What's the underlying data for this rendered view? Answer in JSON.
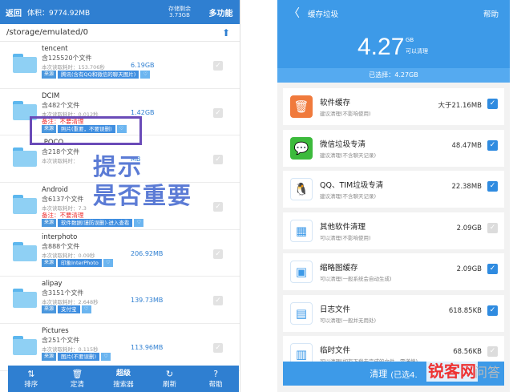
{
  "left": {
    "topbar": {
      "back": "返回",
      "volume": "体积：9774.92MB",
      "storage_line1": "存储剩余",
      "storage_line2": "3.73GB",
      "more": "多功能"
    },
    "path": "/storage/emulated/0",
    "folders": [
      {
        "name": "tencent",
        "count": "含125520个文件",
        "time": "本次读取耗时：153.706秒",
        "size": "6.19GB",
        "tag_a": "来源",
        "tag_b": "腾讯(含有QQ和微信的聊天图片)",
        "note": ""
      },
      {
        "name": "DCIM",
        "count": "含482个文件",
        "time": "本次读取耗时：0.012秒",
        "size": "1.42GB",
        "tag_a": "来源",
        "tag_b": "照片(重要，不要误删)",
        "note": "备注：不要清理"
      },
      {
        "name": ".POCO",
        "count": "含218个文件",
        "time": "本次读取耗时：",
        "size": "MB",
        "tag_a": "",
        "tag_b": "",
        "note": ""
      },
      {
        "name": "Android",
        "count": "含6137个文件",
        "time": "本次读取耗时：7.3",
        "size": "",
        "tag_a": "来源",
        "tag_b": "软件数据(谨防误删)-进入查看",
        "note": "备注：不要清理"
      },
      {
        "name": "interphoto",
        "count": "含888个文件",
        "time": "本次读取耗时：0.09秒",
        "size": "206.92MB",
        "tag_a": "来源",
        "tag_b": "印象InterPhoto",
        "note": ""
      },
      {
        "name": "alipay",
        "count": "含3151个文件",
        "time": "本次读取耗时：2.648秒",
        "size": "139.73MB",
        "tag_a": "来源",
        "tag_b": "支付宝",
        "note": ""
      },
      {
        "name": "Pictures",
        "count": "含251个文件",
        "time": "本次读取耗时：0.115秒",
        "size": "113.96MB",
        "tag_a": "来源",
        "tag_b": "图片(不要误删)",
        "note": ""
      }
    ],
    "overlay_line1": "提示",
    "overlay_line2": "是否重要",
    "bottom_nav": [
      {
        "icon": "⇅",
        "label": "排序"
      },
      {
        "icon": "🗑",
        "label": "定清"
      },
      {
        "icon": "超级",
        "label": "搜索器"
      },
      {
        "icon": "↻",
        "label": "刷新"
      },
      {
        "icon": "?",
        "label": "帮助"
      }
    ]
  },
  "right": {
    "header": {
      "back": "〈",
      "title": "缓存垃圾",
      "help": "帮助",
      "amount": "4.27",
      "unit": "GB",
      "unit_sub": "可以清理"
    },
    "selected_bar": "已选择：4.27GB",
    "items": [
      {
        "title": "软件缓存",
        "desc": "建议清理(不影响使用)",
        "size": "大于21.16MB",
        "checked": true,
        "icon": "trash-icon",
        "color": "#f07a3c"
      },
      {
        "title": "微信垃圾专清",
        "desc": "建议清理(不含聊天记录)",
        "size": "48.47MB",
        "checked": true,
        "icon": "wechat-icon",
        "color": "#3cba3c"
      },
      {
        "title": "QQ、TIM垃圾专清",
        "desc": "建议清理(不含聊天记录)",
        "size": "22.38MB",
        "checked": true,
        "icon": "qq-icon",
        "color": "#ffffff"
      },
      {
        "title": "其他软件清理",
        "desc": "可以清理(不影响使用)",
        "size": "2.09GB",
        "checked": false,
        "icon": "apps-icon",
        "color": "#ffffff"
      },
      {
        "title": "缩略图缓存",
        "desc": "可以清理(一般系统会自动生成)",
        "size": "2.09GB",
        "checked": true,
        "icon": "image-icon",
        "color": "#ffffff"
      },
      {
        "title": "日志文件",
        "desc": "可以清理(一般并无用处)",
        "size": "618.85KB",
        "checked": true,
        "icon": "log-icon",
        "color": "#ffffff"
      },
      {
        "title": "临时文件",
        "desc": "可以清理(如有下载未完成的文件，需谨慎)",
        "size": "68.56KB",
        "checked": false,
        "icon": "temp-file-icon",
        "color": "#ffffff"
      }
    ],
    "bottom": {
      "label": "清理",
      "selected": "(已选4."
    }
  },
  "watermark": {
    "main": "锐客网",
    "sub": "问答"
  }
}
